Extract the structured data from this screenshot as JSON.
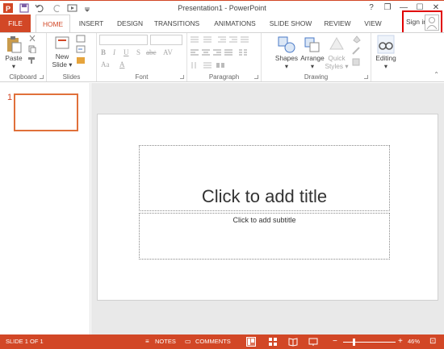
{
  "window": {
    "title": "Presentation1 - PowerPoint",
    "help": "?",
    "restore": "❐",
    "minimize": "—",
    "maximize": "☐",
    "close": "✕"
  },
  "tabs": [
    {
      "label": "FILE"
    },
    {
      "label": "HOME"
    },
    {
      "label": "INSERT"
    },
    {
      "label": "DESIGN"
    },
    {
      "label": "TRANSITIONS"
    },
    {
      "label": "ANIMATIONS"
    },
    {
      "label": "SLIDE SHOW"
    },
    {
      "label": "REVIEW"
    },
    {
      "label": "VIEW"
    }
  ],
  "account": {
    "sign_in": "Sign in"
  },
  "ribbon": {
    "clipboard": {
      "label": "Clipboard",
      "paste": "Paste"
    },
    "slides": {
      "label": "Slides",
      "new_slide_1": "New",
      "new_slide_2": "Slide ▾"
    },
    "font": {
      "label": "Font",
      "bold": "B",
      "italic": "I",
      "underline": "U",
      "strike": "S",
      "shadow": "abc",
      "spacing": "AV",
      "case": "Aa",
      "color": "A"
    },
    "paragraph": {
      "label": "Paragraph"
    },
    "drawing": {
      "label": "Drawing",
      "shapes": "Shapes",
      "arrange": "Arrange",
      "quick_styles_1": "Quick",
      "quick_styles_2": "Styles ▾"
    },
    "editing": {
      "label": "Editing"
    },
    "collapse": "⌃"
  },
  "slide_pane": {
    "number": "1"
  },
  "slide": {
    "title_placeholder": "Click to add title",
    "subtitle_placeholder": "Click to add subtitle"
  },
  "status": {
    "slide_of": "SLIDE 1 OF 1",
    "notes": "NOTES",
    "comments": "COMMENTS",
    "zoom": "46%",
    "zoom_minus": "−",
    "zoom_plus": "+",
    "fit": "⊡"
  },
  "colors": {
    "accent": "#d24726",
    "signin_highlight": "#e00000"
  },
  "zoom_level": 0.46
}
